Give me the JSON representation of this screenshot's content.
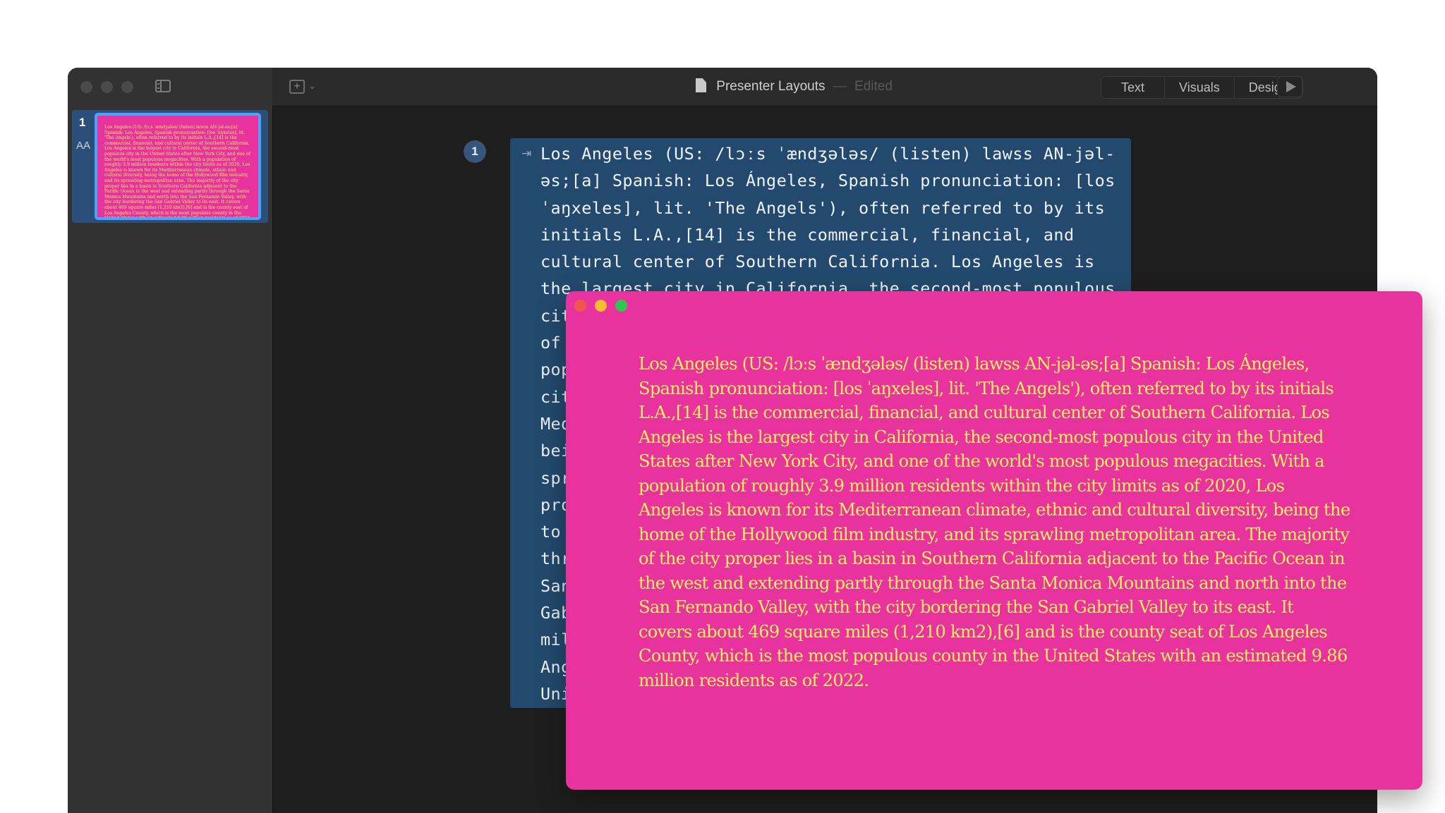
{
  "window": {
    "title": "Presenter Layouts",
    "separator": "—",
    "status": "Edited"
  },
  "toolbar": {
    "add_symbol": "+",
    "chevron": "⌄",
    "tabs": [
      "Text",
      "Visuals",
      "Design"
    ]
  },
  "sidebar": {
    "slide_number": "1",
    "aa_label": "AA"
  },
  "slide": {
    "step_number": "1",
    "text": "Los Angeles (US: /lɔːs ˈændʒələs/ (listen) lawss AN-jəl-əs;[a] Spanish: Los Ángeles, Spanish pronunciation: [los ˈaŋxeles], lit. 'The Angels'), often referred to by its initials L.A.,[14] is the commercial, financial, and cultural center of Southern California. Los Angeles is the largest city in California, the second-most populous city in the United States after New York City, and one of the world's most populous megacities. With a population of roughly 3.9 million residents within the city limits as of 2020, Los Angeles is known for its Mediterranean climate, ethnic and cultural diversity, being the home of the Hollywood film industry, and its sprawling metropolitan area. The majority of the city proper lies in a basin in Southern California adjacent to the Pacific Ocean in the west and extending partly through the Santa Monica Mountains and north into the San Fernando Valley, with the city bordering the San Gabriel Valley to its east. It covers about 469 square miles (1,210 km2),[6] and is the county seat of Los Angeles County, which is the most populous county in the United States with an estimated 9.86 million residents as of 2022."
  },
  "colors": {
    "slide_background": "#e8339e",
    "slide_text": "#ffee60",
    "selection_accent": "#4da3f8",
    "editor_block": "#234a6e"
  },
  "icons": {
    "sidebar_toggle": "sidebar-toggle-icon",
    "add": "add-slide-icon",
    "document": "document-icon",
    "play": "play-icon",
    "indent": "indent-arrow-icon"
  }
}
